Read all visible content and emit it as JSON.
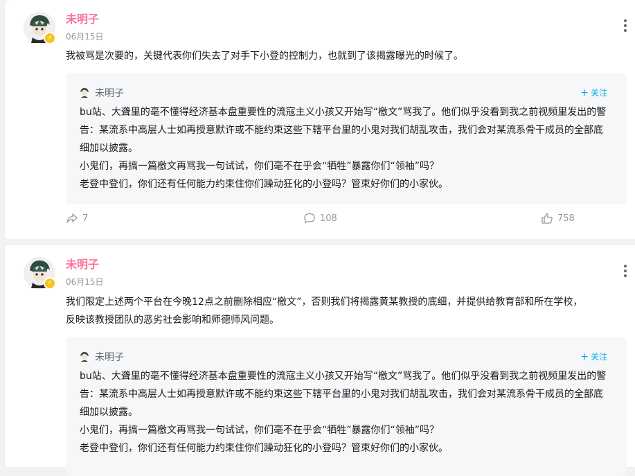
{
  "colors": {
    "name": "#fb7299",
    "follow": "#00aeec",
    "muted": "#9499a0"
  },
  "posts": [
    {
      "author": "未明子",
      "date": "06月15日",
      "text": [
        "我被骂是次要的，关键代表你们失去了对手下小登的控制力，也就到了该揭露曝光的时候了。"
      ],
      "quoted": {
        "author": "未明子",
        "follow_label": "关注",
        "paragraphs": [
          "bu站、大聋里的毫不懂得经济基本盘重要性的流寇主义小孩又开始写“檄文”骂我了。他们似乎没看到我之前视频里发出的警告：某流系中高层人士如再授意默许或不能约束这些下辖平台里的小鬼对我们胡乱攻击，我们会对某流系骨干成员的全部底细加以披露。",
          "小鬼们，再搞一篇檄文再骂我一句试试，你们毫不在乎会“牺牲”暴露你们“领袖”吗？",
          "老登中登们，你们还有任何能力约束住你们躁动狂化的小登吗？管束好你们的小家伙。"
        ]
      },
      "stats": {
        "shares": "7",
        "comments": "108",
        "likes": "758"
      }
    },
    {
      "author": "未明子",
      "date": "06月15日",
      "text": [
        "我们限定上述两个平台在今晚12点之前删除相应“檄文”，否则我们将揭露黄某教授的底细，并提供给教育部和所在学校，",
        "反映该教授团队的恶劣社会影响和师德师风问题。"
      ],
      "quoted": {
        "author": "未明子",
        "follow_label": "关注",
        "paragraphs": [
          "bu站、大聋里的毫不懂得经济基本盘重要性的流寇主义小孩又开始写“檄文”骂我了。他们似乎没看到我之前视频里发出的警告：某流系中高层人士如再授意默许或不能约束这些下辖平台里的小鬼对我们胡乱攻击，我们会对某流系骨干成员的全部底细加以披露。",
          "小鬼们，再搞一篇檄文再骂我一句试试，你们毫不在乎会“牺牲”暴露你们“领袖”吗？",
          "老登中登们，你们还有任何能力约束住你们躁动狂化的小登吗？管束好你们的小家伙。"
        ]
      }
    }
  ]
}
